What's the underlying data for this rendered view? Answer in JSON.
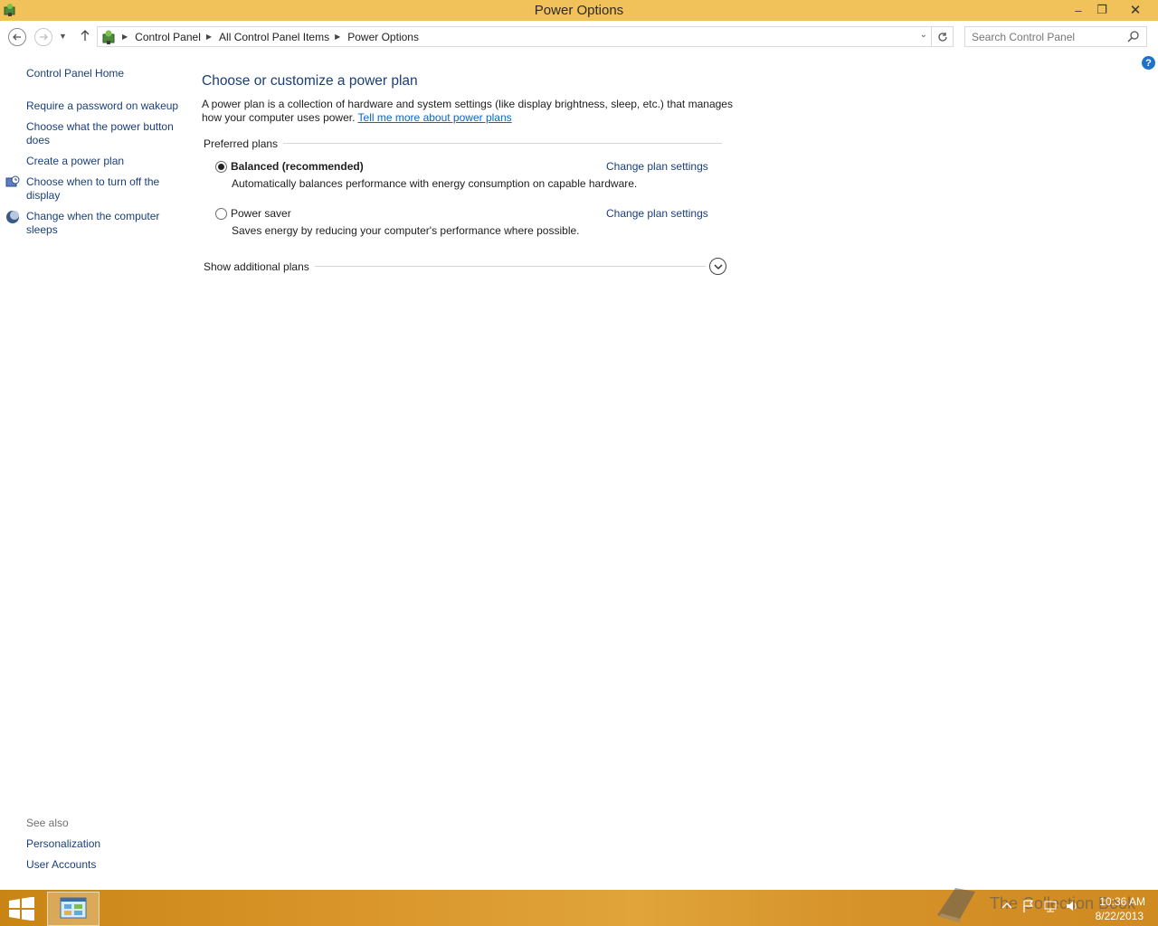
{
  "window": {
    "title": "Power Options",
    "controls": {
      "minimize": "–",
      "maximize": "❐",
      "close": "✕"
    }
  },
  "navigation": {
    "breadcrumbs": [
      "Control Panel",
      "All Control Panel Items",
      "Power Options"
    ],
    "search_placeholder": "Search Control Panel"
  },
  "left_pane": {
    "home": "Control Panel Home",
    "links": [
      "Require a password on wakeup",
      "Choose what the power button does",
      "Create a power plan",
      "Choose when to turn off the display",
      "Change when the computer sleeps"
    ],
    "see_also_label": "See also",
    "see_also_links": [
      "Personalization",
      "User Accounts"
    ]
  },
  "main": {
    "title": "Choose or customize a power plan",
    "description": "A power plan is a collection of hardware and system settings (like display brightness, sleep, etc.) that manages how your computer uses power.",
    "learn_more": "Tell me more about power plans",
    "group_label": "Preferred plans",
    "plans": [
      {
        "name": "Balanced (recommended)",
        "description": "Automatically balances performance with energy consumption on capable hardware.",
        "link": "Change plan settings",
        "selected": true
      },
      {
        "name": "Power saver",
        "description": "Saves energy by reducing your computer's performance where possible.",
        "link": "Change plan settings",
        "selected": false
      }
    ],
    "show_additional": "Show additional plans"
  },
  "taskbar": {
    "time": "10:36 AM",
    "date": "8/22/2013",
    "watermark": "The Collection Book"
  },
  "colors": {
    "titlebar": "#f1c15a",
    "link": "#1a3e7a",
    "taskbar": "#d9952a"
  }
}
